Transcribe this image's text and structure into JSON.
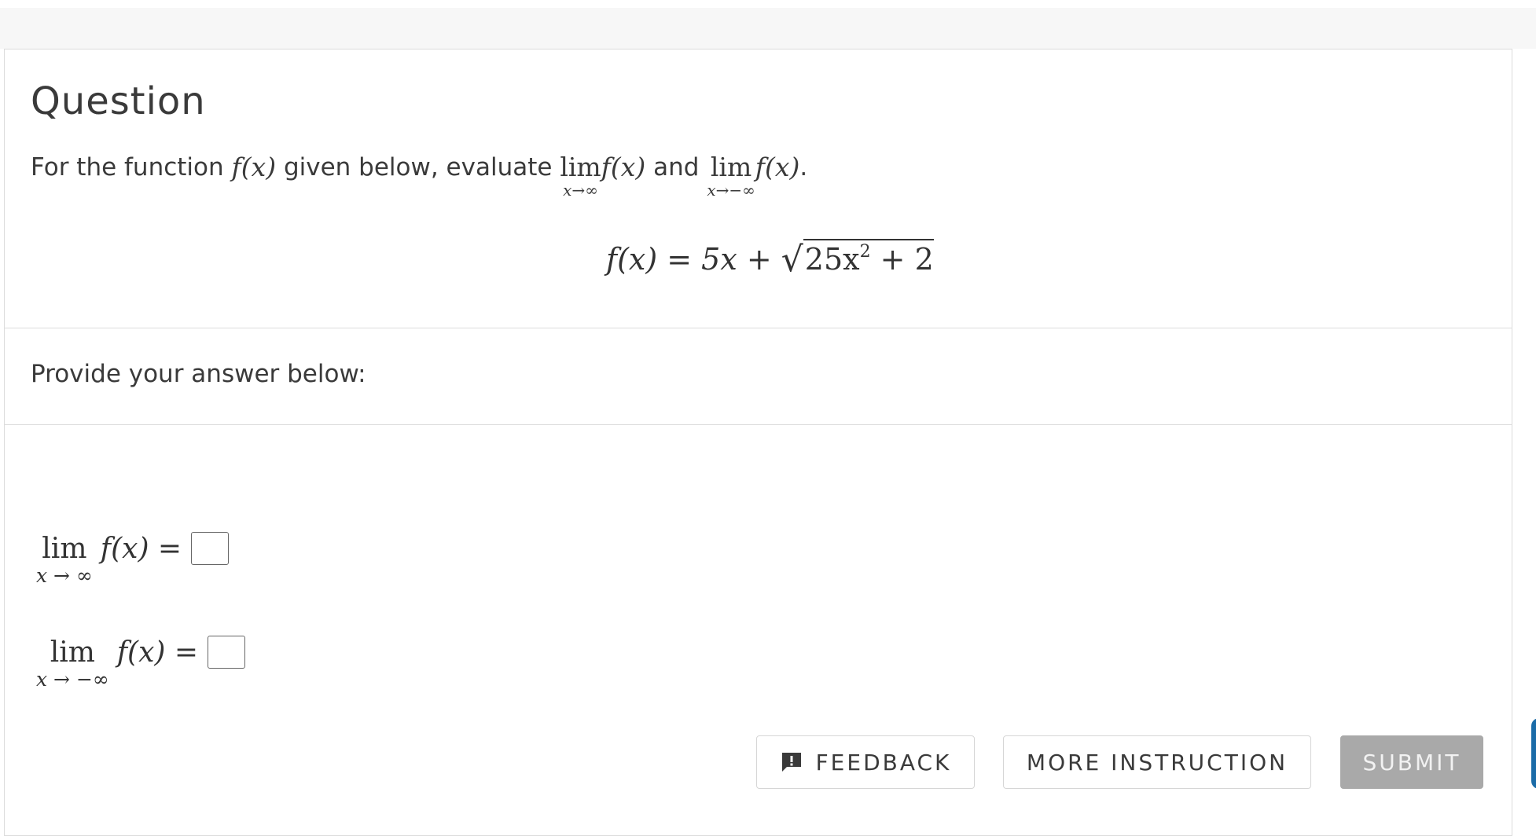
{
  "question": {
    "title": "Question",
    "prompt_prefix": "For the function ",
    "prompt_fx": "f(x)",
    "prompt_mid": " given below, evaluate ",
    "lim1_word": "lim",
    "lim1_sub": "x→∞",
    "lim1_fx": "f(x)",
    "prompt_and": " and ",
    "lim2_word": "lim",
    "lim2_sub": "x→−∞",
    "lim2_fx": "f(x)",
    "prompt_end": ".",
    "equation_lhs": "f(x) = 5x + ",
    "sqrt_content": "25x",
    "sqrt_exp": "2",
    "sqrt_tail": " + 2"
  },
  "answer_section": {
    "label": "Provide your answer below:",
    "rows": [
      {
        "lim": "lim",
        "sub": "x → ∞",
        "rhs": "f(x) ="
      },
      {
        "lim": "lim",
        "sub": "x → −∞",
        "rhs": "f(x) ="
      }
    ]
  },
  "buttons": {
    "feedback": "FEEDBACK",
    "more_instruction": "MORE INSTRUCTION",
    "submit": "SUBMIT"
  },
  "colors": {
    "submit_bg": "#a9a9a9",
    "border": "#dcdcdc",
    "text": "#3a3a3a"
  },
  "icons": {
    "feedback": "feedback-exclamation-icon"
  }
}
